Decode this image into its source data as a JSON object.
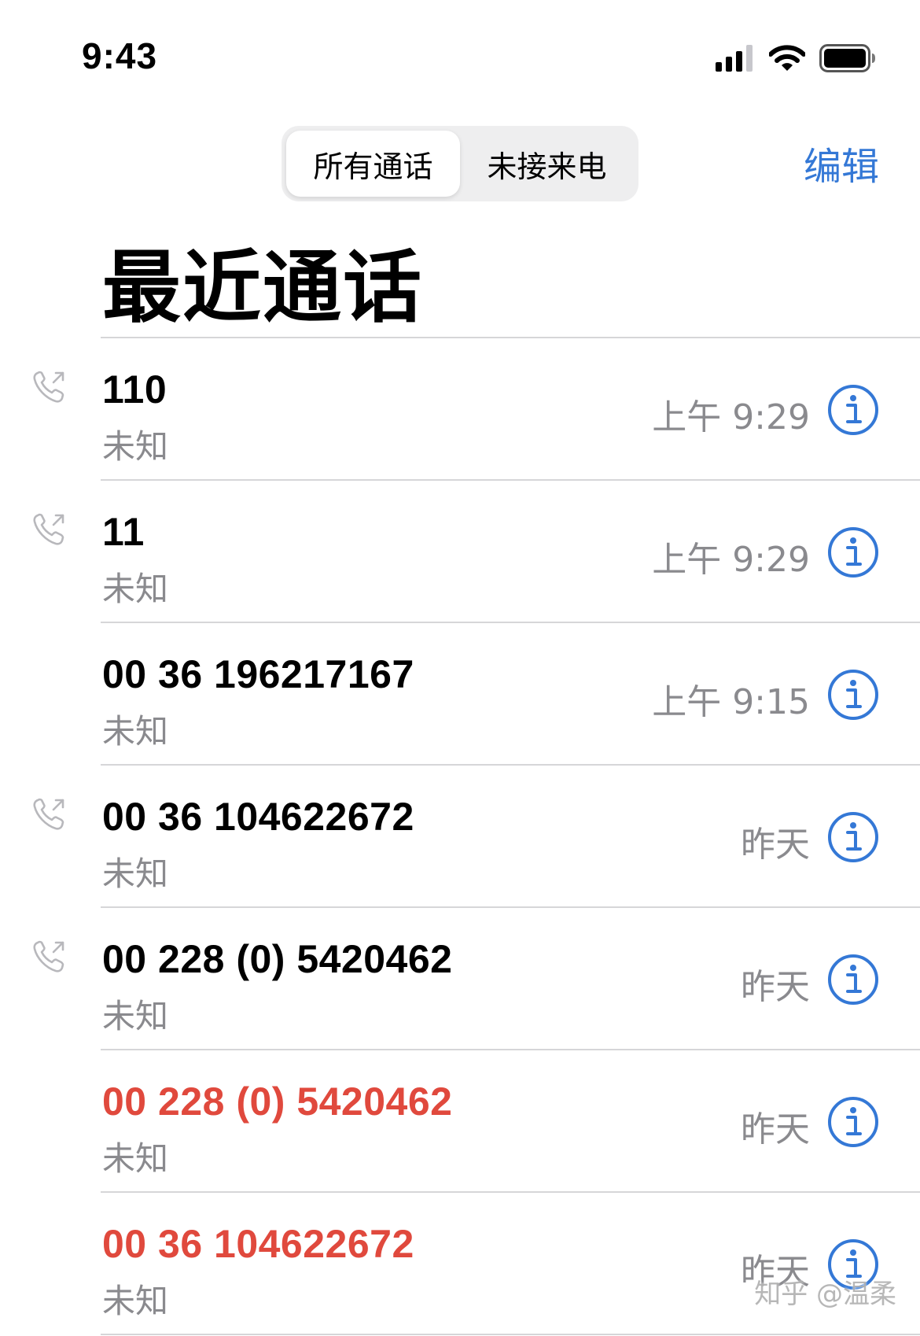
{
  "status_bar": {
    "time": "9:43",
    "icons": [
      "cellular-signal-icon",
      "wifi-icon",
      "battery-icon"
    ]
  },
  "nav": {
    "segments": [
      {
        "label": "所有通话",
        "active": true
      },
      {
        "label": "未接来电",
        "active": false
      }
    ],
    "edit_label": "编辑"
  },
  "title": "最近通话",
  "colors": {
    "accent": "#3478d6",
    "missed": "#e0493d",
    "secondary_text": "#8a8a8e",
    "divider": "#d6d6d8"
  },
  "calls": [
    {
      "number": "110",
      "label": "未知",
      "time": "上午 9:29",
      "outgoing": true,
      "missed": false
    },
    {
      "number": "11",
      "label": "未知",
      "time": "上午 9:29",
      "outgoing": true,
      "missed": false
    },
    {
      "number": "00 36 196217167",
      "label": "未知",
      "time": "上午 9:15",
      "outgoing": false,
      "missed": false
    },
    {
      "number": "00 36 104622672",
      "label": "未知",
      "time": "昨天",
      "outgoing": true,
      "missed": false
    },
    {
      "number": "00 228 (0) 5420462",
      "label": "未知",
      "time": "昨天",
      "outgoing": true,
      "missed": false
    },
    {
      "number": "00 228 (0) 5420462",
      "label": "未知",
      "time": "昨天",
      "outgoing": false,
      "missed": true
    },
    {
      "number": "00 36 104622672",
      "label": "未知",
      "time": "昨天",
      "outgoing": false,
      "missed": true
    }
  ],
  "watermark": "知乎 @温柔"
}
